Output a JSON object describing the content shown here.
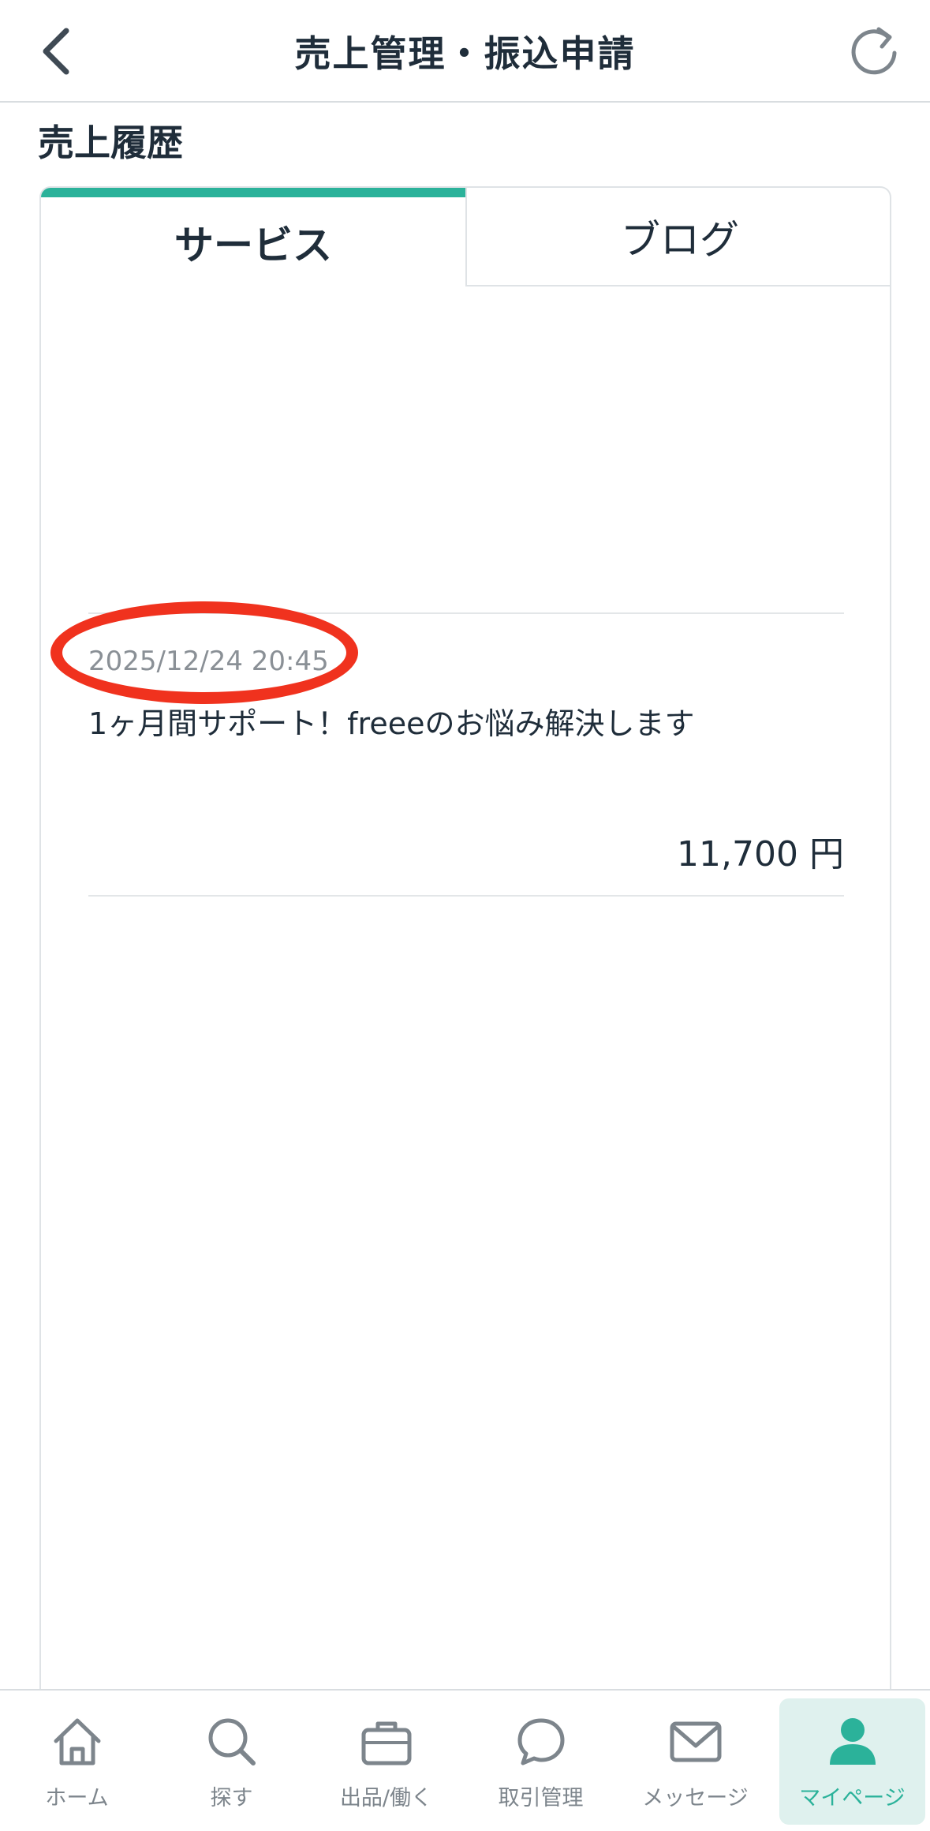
{
  "header": {
    "title": "売上管理・振込申請",
    "back_icon": "chevron-left-icon",
    "refresh_icon": "refresh-icon"
  },
  "section": {
    "title": "売上履歴"
  },
  "tabs": [
    {
      "label": "サービス",
      "active": true
    },
    {
      "label": "ブログ",
      "active": false
    }
  ],
  "sales": [
    {
      "date": "2025/12/24 20:45",
      "title": "1ヶ月間サポート！freeeのお悩み解決します",
      "amount": "11,700 円"
    }
  ],
  "bottom_nav": [
    {
      "label": "ホーム",
      "icon": "home-icon",
      "active": false
    },
    {
      "label": "探す",
      "icon": "search-icon",
      "active": false
    },
    {
      "label": "出品/働く",
      "icon": "briefcase-icon",
      "active": false
    },
    {
      "label": "取引管理",
      "icon": "chat-bubble-icon",
      "active": false
    },
    {
      "label": "メッセージ",
      "icon": "envelope-icon",
      "active": false
    },
    {
      "label": "マイページ",
      "icon": "user-icon",
      "active": true
    }
  ],
  "colors": {
    "accent": "#2bb29a",
    "annotation": "#f0321e",
    "text": "#1f2d3a",
    "muted": "#8a9096"
  }
}
